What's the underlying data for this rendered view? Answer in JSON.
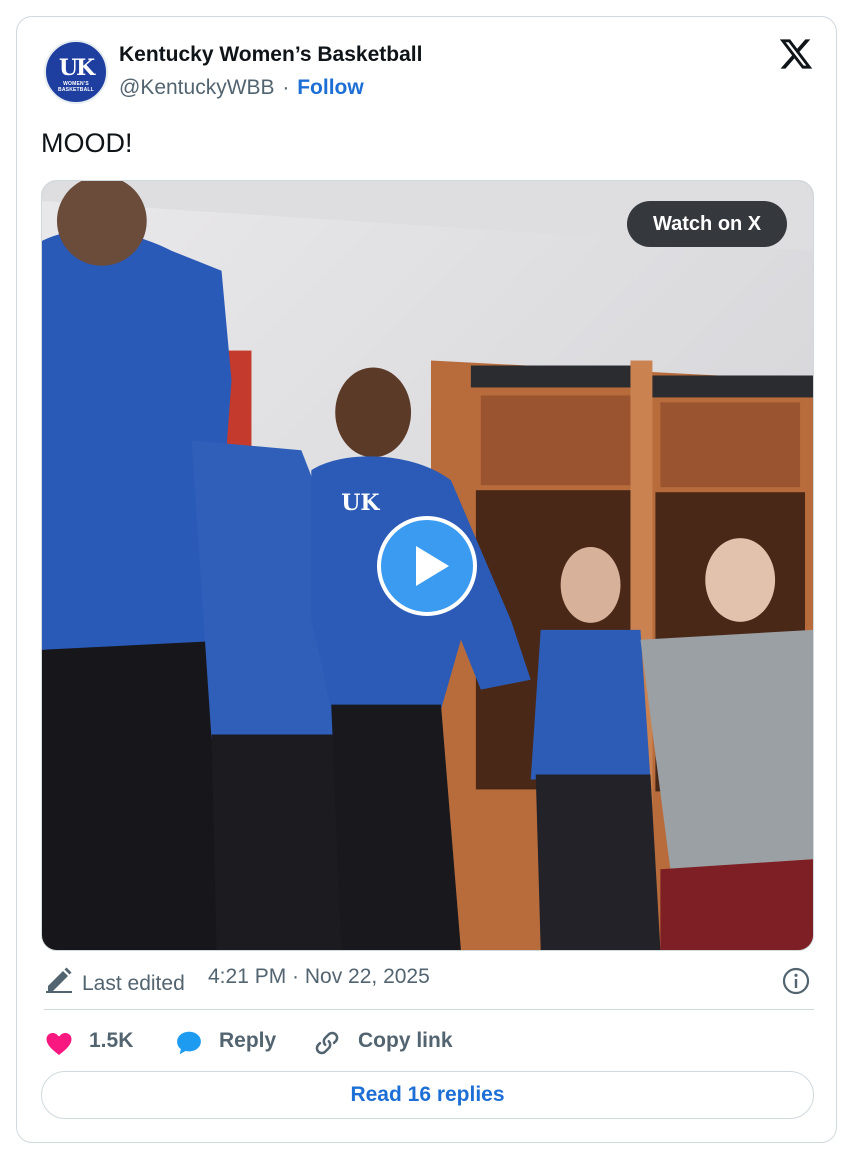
{
  "account": {
    "name": "Kentucky Women’s Basketball",
    "handle": "@KentuckyWBB",
    "separator": "·",
    "follow_label": "Follow",
    "avatar_logo": "UK",
    "avatar_subtext": "WOMEN’S BASKETBALL"
  },
  "tweet": {
    "text": "MOOD!"
  },
  "media": {
    "watch_label": "Watch on X",
    "play_icon": "play-icon"
  },
  "meta": {
    "edited_label": "Last edited",
    "timestamp": "4:21 PM · Nov 22, 2025"
  },
  "actions": {
    "likes_count": "1.5K",
    "reply_label": "Reply",
    "copy_label": "Copy link"
  },
  "footer": {
    "read_replies_label": "Read 16 replies"
  },
  "colors": {
    "link_blue": "#1d6fd6",
    "like_pink": "#f91880",
    "reply_blue": "#1d9bf0",
    "muted_text": "#536471",
    "border": "#cfd9de"
  }
}
